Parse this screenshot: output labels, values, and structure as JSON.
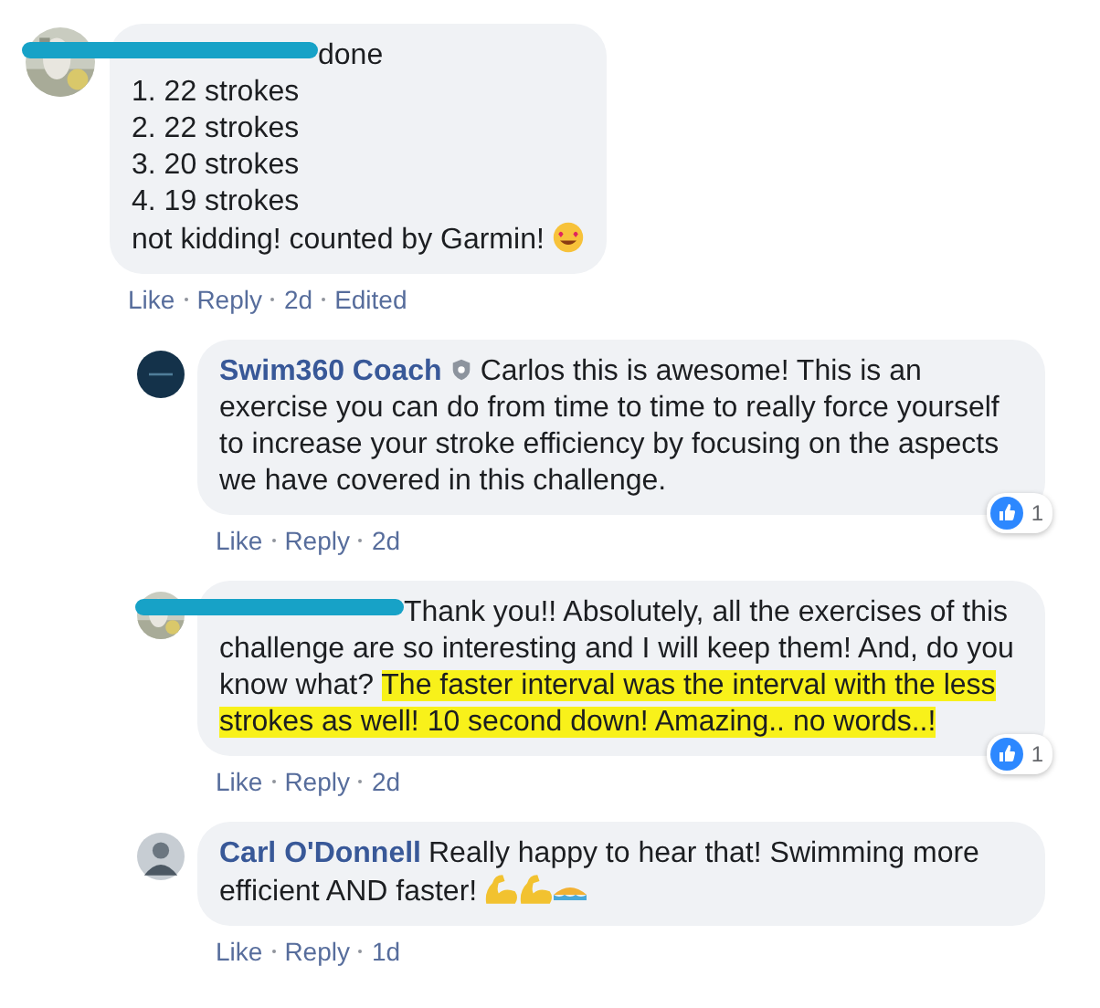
{
  "comments": [
    {
      "author": {
        "redacted": true
      },
      "avatar": {
        "kind": "picture"
      },
      "body": [
        {
          "kind": "text",
          "parts": [
            {
              "text": "done",
              "highlighted": false
            }
          ]
        },
        {
          "kind": "break"
        },
        {
          "kind": "text",
          "parts": [
            {
              "text": "1. 22 strokes",
              "highlighted": false
            }
          ]
        },
        {
          "kind": "break"
        },
        {
          "kind": "text",
          "parts": [
            {
              "text": "2. 22 strokes",
              "highlighted": false
            }
          ]
        },
        {
          "kind": "break"
        },
        {
          "kind": "text",
          "parts": [
            {
              "text": "3. 20 strokes",
              "highlighted": false
            }
          ]
        },
        {
          "kind": "break"
        },
        {
          "kind": "text",
          "parts": [
            {
              "text": "4. 19 strokes",
              "highlighted": false
            }
          ]
        },
        {
          "kind": "break"
        },
        {
          "kind": "text",
          "parts": [
            {
              "text": "not kidding! counted by Garmin!",
              "highlighted": false
            }
          ]
        },
        {
          "kind": "love-emoji"
        }
      ],
      "actions": [
        "Like",
        "Reply",
        "2d",
        "Edited"
      ],
      "replies": [
        {
          "author": {
            "redacted": false,
            "name": "Swim360 Coach",
            "badge": true
          },
          "avatar": {
            "kind": "logo"
          },
          "body": [
            {
              "kind": "text",
              "parts": [
                {
                  "text": "Carlos this is awesome! This is an exercise you can do from time to time to really force yourself to increase your stroke efficiency by focusing on the aspects we have covered in this challenge.",
                  "highlighted": false
                }
              ]
            }
          ],
          "actions": [
            "Like",
            "Reply",
            "2d"
          ],
          "reactions": {
            "count": "1"
          }
        },
        {
          "author": {
            "redacted": true
          },
          "avatar": {
            "kind": "picture"
          },
          "body": [
            {
              "kind": "text",
              "parts": [
                {
                  "text": "Thank you!! Absolutely, all the exercises of this challenge are so interesting and I will keep them! And, do you know what? ",
                  "highlighted": false
                },
                {
                  "text": "The faster interval was the interval with the less strokes as well! 10 second down! Amazing.. no words..!",
                  "highlighted": true
                }
              ]
            }
          ],
          "actions": [
            "Like",
            "Reply",
            "2d"
          ],
          "reactions": {
            "count": "1"
          }
        },
        {
          "author": {
            "redacted": false,
            "name": "Carl O'Donnell",
            "badge": false
          },
          "avatar": {
            "kind": "silhouette"
          },
          "body": [
            {
              "kind": "text",
              "parts": [
                {
                  "text": "Really happy to hear that! Swimming more efficient AND faster!",
                  "highlighted": false
                }
              ]
            },
            {
              "kind": "muscle-emoji"
            },
            {
              "kind": "muscle-emoji"
            },
            {
              "kind": "swim-emoji"
            }
          ],
          "actions": [
            "Like",
            "Reply",
            "1d"
          ]
        }
      ]
    }
  ]
}
